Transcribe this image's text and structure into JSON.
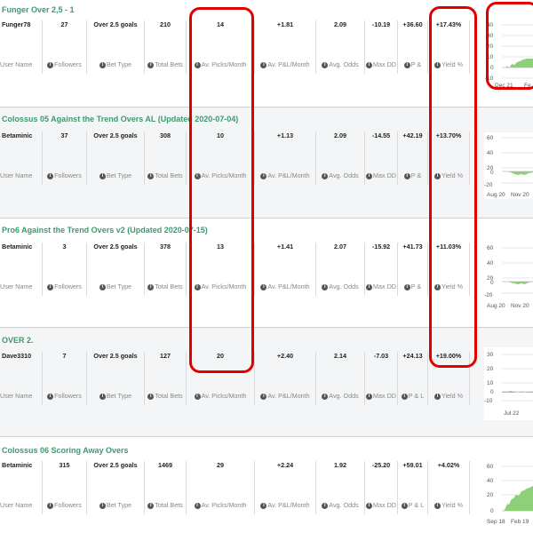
{
  "labels": {
    "user_name": "User Name",
    "followers": "Followers",
    "bet_type": "Bet Type",
    "total_bets": "Total Bets",
    "av_picks": "Av. Picks/Month",
    "av_pl": "Av. P&L/Month",
    "avg_odds": "Avg. Odds",
    "max_dd": "Max DD",
    "pl_full": "P & L",
    "pl_short": "P &",
    "yield": "Yield %"
  },
  "icons": {
    "info": "info-circle-icon"
  },
  "colors": {
    "title_green": "#3b9b6e",
    "negative_red": "#dd2222",
    "highlight_red": "#e00000",
    "chart_fill": "#8ed07a"
  },
  "tipsters": [
    {
      "title": "Funger Over 2,5 - 1",
      "user": "Funger78",
      "followers": "27",
      "bet_type": "Over 2.5 goals",
      "total_bets": "210",
      "av_picks": "14",
      "av_pl": "+1.81",
      "avg_odds": "2.09",
      "max_dd": "-10.19",
      "pl": "+36.60",
      "yield": "+17.43%",
      "chart": {
        "yticks": [
          "40",
          "30",
          "20",
          "10",
          "0",
          "-10"
        ],
        "xticks": [
          "Dec 21",
          "Fe"
        ],
        "ylim": [
          -10,
          40
        ]
      }
    },
    {
      "title": "Colossus 05 Against the Trend Overs AL (Updated 2020-07-04)",
      "user": "Betaminic",
      "followers": "37",
      "bet_type": "Over 2.5 goals",
      "total_bets": "308",
      "av_picks": "10",
      "av_pl": "+1.13",
      "avg_odds": "2.09",
      "max_dd": "-14.55",
      "pl": "+42.19",
      "yield": "+13.70%",
      "chart": {
        "yticks": [
          "60",
          "40",
          "20",
          "0",
          "-20"
        ],
        "xticks": [
          "Aug 20",
          "Nov 20"
        ],
        "ylim": [
          -20,
          60
        ]
      }
    },
    {
      "title": "Pro6 Against the Trend Overs v2 (Updated 2020-07-15)",
      "user": "Betaminic",
      "followers": "3",
      "bet_type": "Over 2.5 goals",
      "total_bets": "378",
      "av_picks": "13",
      "av_pl": "+1.41",
      "avg_odds": "2.07",
      "max_dd": "-15.92",
      "pl": "+41.73",
      "yield": "+11.03%",
      "chart": {
        "yticks": [
          "60",
          "40",
          "20",
          "0",
          "-20"
        ],
        "xticks": [
          "Aug 20",
          "Nov 20"
        ],
        "ylim": [
          -20,
          60
        ]
      }
    },
    {
      "title": "OVER 2.",
      "user": "Dave3310",
      "followers": "7",
      "bet_type": "Over 2.5 goals",
      "total_bets": "127",
      "av_picks": "20",
      "av_pl": "+2.40",
      "avg_odds": "2.14",
      "max_dd": "-7.03",
      "pl": "+24.13",
      "yield": "+19.00%",
      "chart": {
        "yticks": [
          "30",
          "20",
          "10",
          "0",
          "-10"
        ],
        "xticks": [
          "Jul 22"
        ],
        "ylim": [
          -10,
          30
        ]
      }
    },
    {
      "title": "Colossus 06 Scoring Away Overs",
      "user": "Betaminic",
      "followers": "315",
      "bet_type": "Over 2.5 goals",
      "total_bets": "1469",
      "av_picks": "29",
      "av_pl": "+2.24",
      "avg_odds": "1.92",
      "max_dd": "-25.20",
      "pl": "+59.01",
      "yield": "+4.02%",
      "chart": {
        "yticks": [
          "60",
          "40",
          "20",
          "0"
        ],
        "xticks": [
          "Sep 18",
          "Feb 19"
        ],
        "ylim": [
          0,
          60
        ]
      }
    }
  ]
}
